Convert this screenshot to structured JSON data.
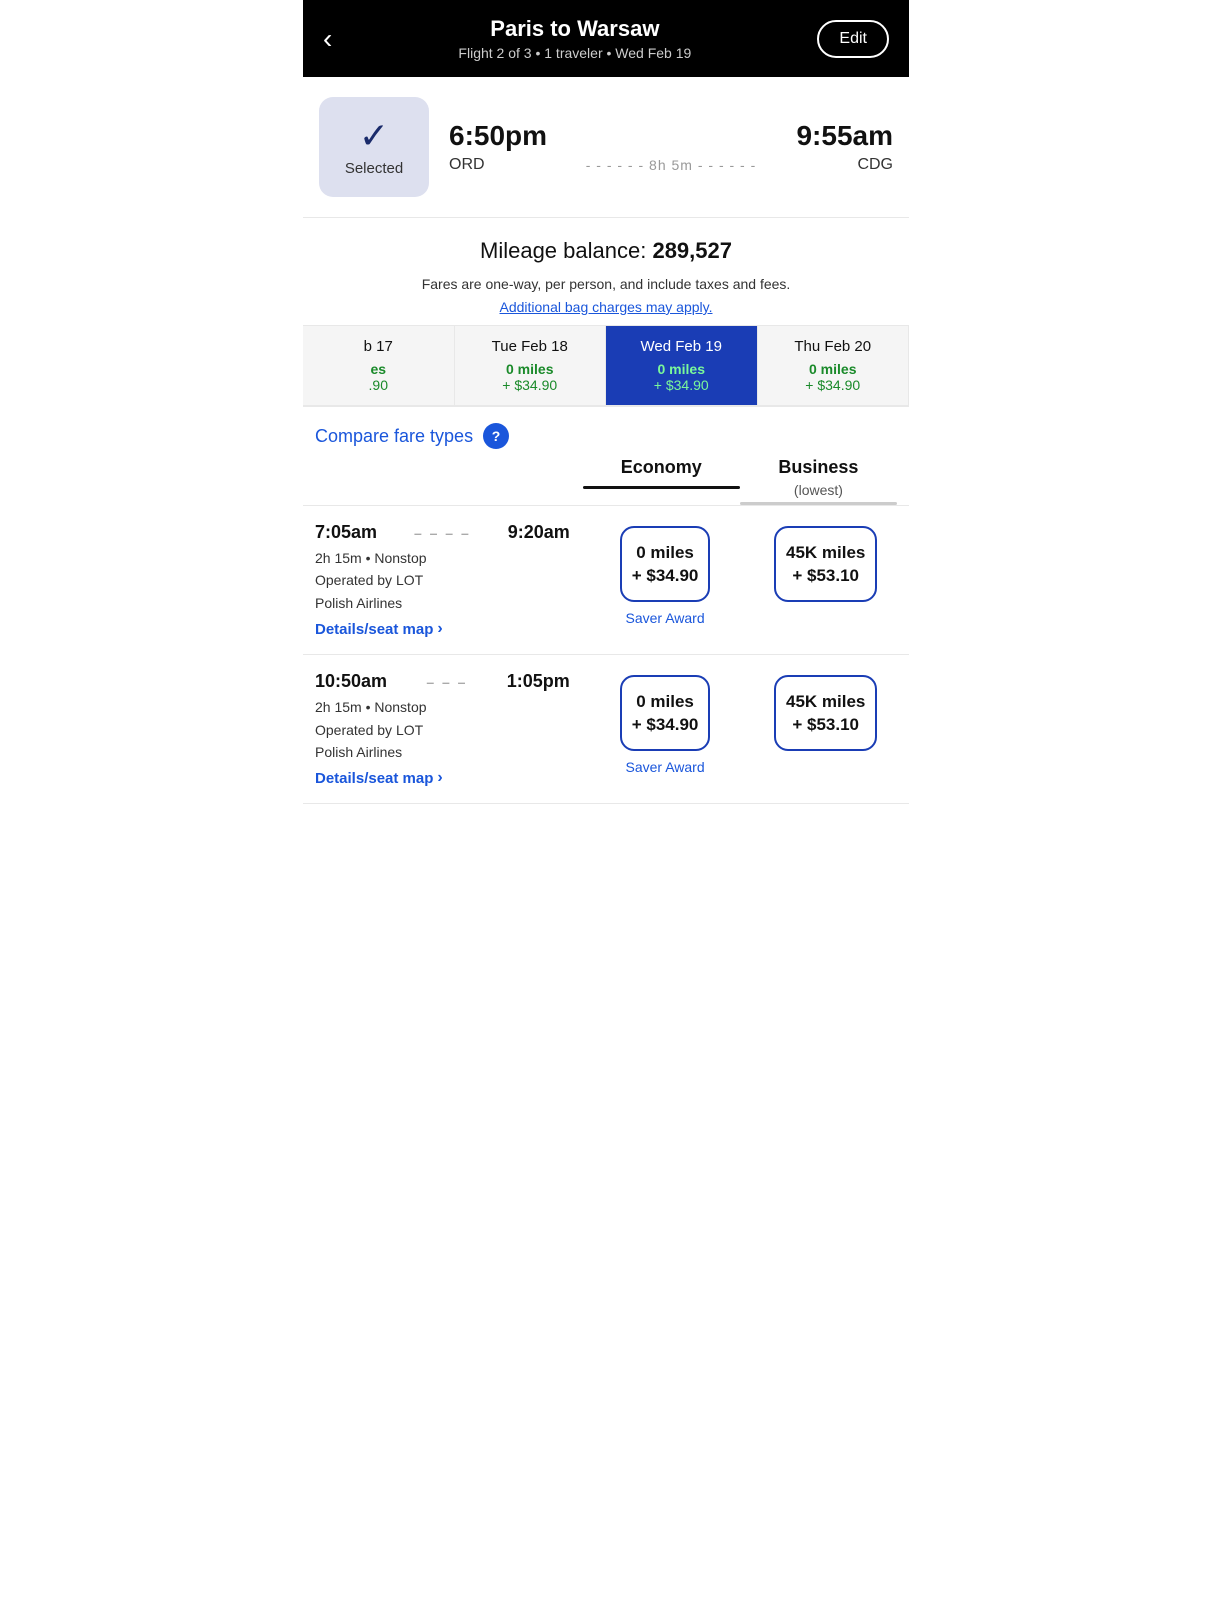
{
  "header": {
    "title": "Paris to Warsaw",
    "subtitle": "Flight 2 of 3 • 1 traveler • Wed Feb 19",
    "back_label": "‹",
    "edit_label": "Edit"
  },
  "selected_flight": {
    "badge_label": "Selected",
    "depart_time": "6:50pm",
    "arrive_time": "9:55am",
    "depart_airport": "ORD",
    "route_duration": "8h 5m",
    "arrive_airport": "CDG"
  },
  "mileage": {
    "label": "Mileage balance: ",
    "balance": "289,527",
    "fare_note": "Fares are one-way, per person, and include taxes and fees.",
    "bag_link": "Additional bag charges may apply."
  },
  "date_tabs": [
    {
      "label": "b 17",
      "miles": "es",
      "price": ".90",
      "active": false,
      "partial": true
    },
    {
      "label": "Tue Feb 18",
      "miles": "0 miles",
      "price": "+ $34.90",
      "active": false,
      "partial": false
    },
    {
      "label": "Wed Feb 19",
      "miles": "0 miles",
      "price": "+ $34.90",
      "active": true,
      "partial": false
    },
    {
      "label": "Thu Feb 20",
      "miles": "0 miles",
      "price": "+ $34.90",
      "active": false,
      "partial": false
    }
  ],
  "compare_section": {
    "link_label": "Compare fare types",
    "help_icon": "?"
  },
  "columns": {
    "economy_label": "Economy",
    "business_label": "Business",
    "business_sub": "(lowest)"
  },
  "flights": [
    {
      "depart": "7:05am",
      "arrive": "9:20am",
      "duration": "2h 15m",
      "stops": "Nonstop",
      "operator": "Operated by LOT\nPolish Airlines",
      "details_label": "Details/seat map",
      "economy": {
        "miles": "0 miles",
        "price": "+ $34.90",
        "award_label": "Saver Award"
      },
      "business": {
        "miles": "45K miles",
        "price": "+ $53.10"
      }
    },
    {
      "depart": "10:50am",
      "arrive": "1:05pm",
      "duration": "2h 15m",
      "stops": "Nonstop",
      "operator": "Operated by LOT\nPolish Airlines",
      "details_label": "Details/seat map",
      "economy": {
        "miles": "0 miles",
        "price": "+ $34.90",
        "award_label": "Saver Award"
      },
      "business": {
        "miles": "45K miles",
        "price": "+ $53.10"
      }
    }
  ],
  "colors": {
    "accent_blue": "#1a3db5",
    "link_blue": "#1a56db",
    "green": "#1a8a2a",
    "black": "#111111",
    "selected_bg": "#dde0ef"
  }
}
